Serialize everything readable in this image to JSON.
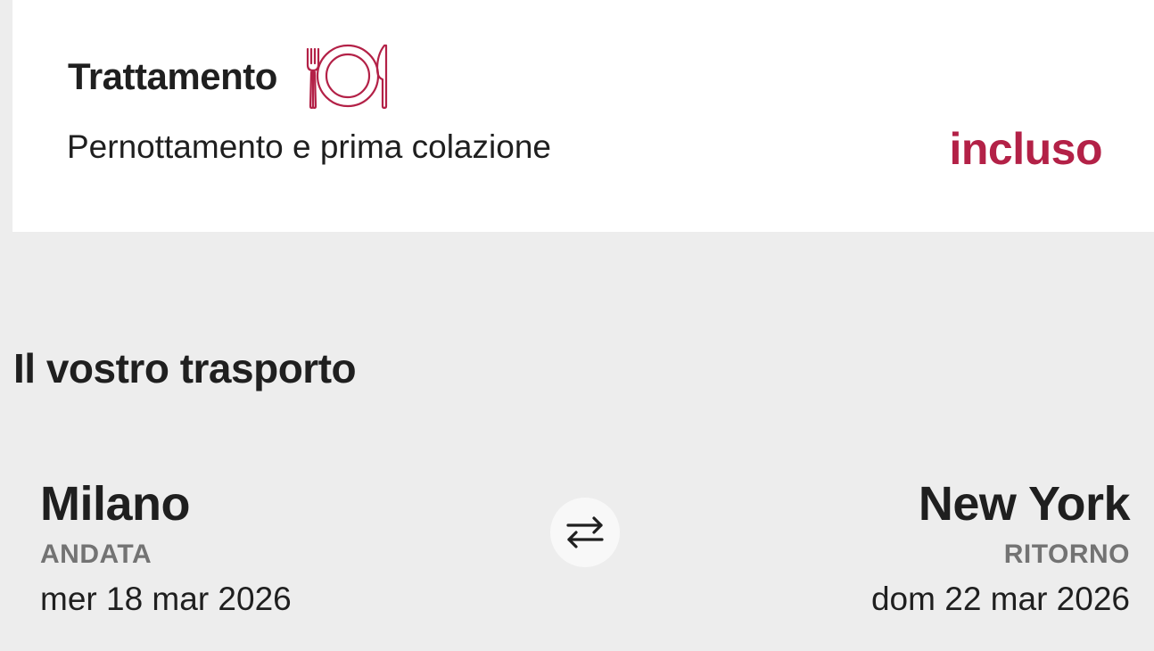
{
  "treatment": {
    "title": "Trattamento",
    "icon": "plate-cutlery-icon",
    "description": "Pernottamento e prima colazione",
    "price_label": "incluso",
    "accent_color": "#b32147"
  },
  "transport": {
    "section_title": "Il vostro trasporto",
    "outbound": {
      "city": "Milano",
      "type": "ANDATA",
      "date": "mer 18 mar 2026"
    },
    "return": {
      "city": "New York",
      "type": "RITORNO",
      "date": "dom 22 mar 2026"
    },
    "swap_icon": "swap-arrows-icon"
  }
}
